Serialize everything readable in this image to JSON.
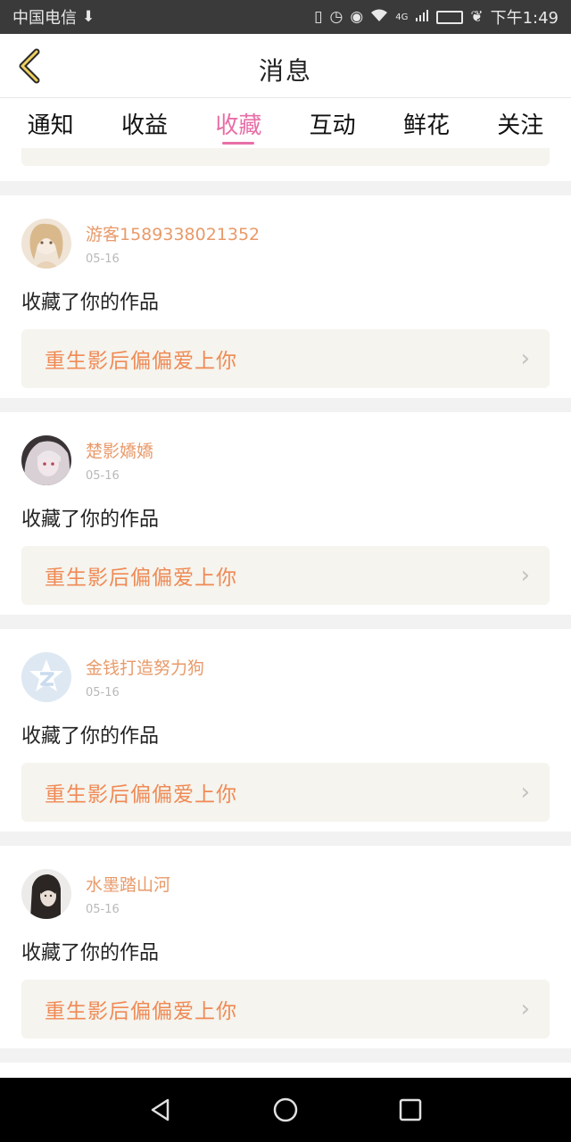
{
  "status_bar": {
    "carrier": "中国电信",
    "network": "4G",
    "time": "下午1:49"
  },
  "header": {
    "title": "消息"
  },
  "tabs": [
    {
      "label": "通知"
    },
    {
      "label": "收益"
    },
    {
      "label": "收藏"
    },
    {
      "label": "互动"
    },
    {
      "label": "鲜花"
    },
    {
      "label": "关注"
    }
  ],
  "active_tab": "收藏",
  "messages": [
    {
      "username": "游客15893380213​52",
      "date": "05-16",
      "action": "收藏了你的作品",
      "work_title": "重生影后偏偏爱上你"
    },
    {
      "username": "楚影嬌嬌",
      "date": "05-16",
      "action": "收藏了你的作品",
      "work_title": "重生影后偏偏爱上你"
    },
    {
      "username": "金钱打造努力狗",
      "date": "05-16",
      "action": "收藏了你的作品",
      "work_title": "重生影后偏偏爱上你"
    },
    {
      "username": "水墨踏山河",
      "date": "05-16",
      "action": "收藏了你的作品",
      "work_title": "重生影后偏偏爱上你"
    }
  ],
  "colors": {
    "accent": "#e86fa7",
    "username": "#e89a6a",
    "work_title": "#f08a55",
    "card_bg": "#f5f4ee"
  }
}
